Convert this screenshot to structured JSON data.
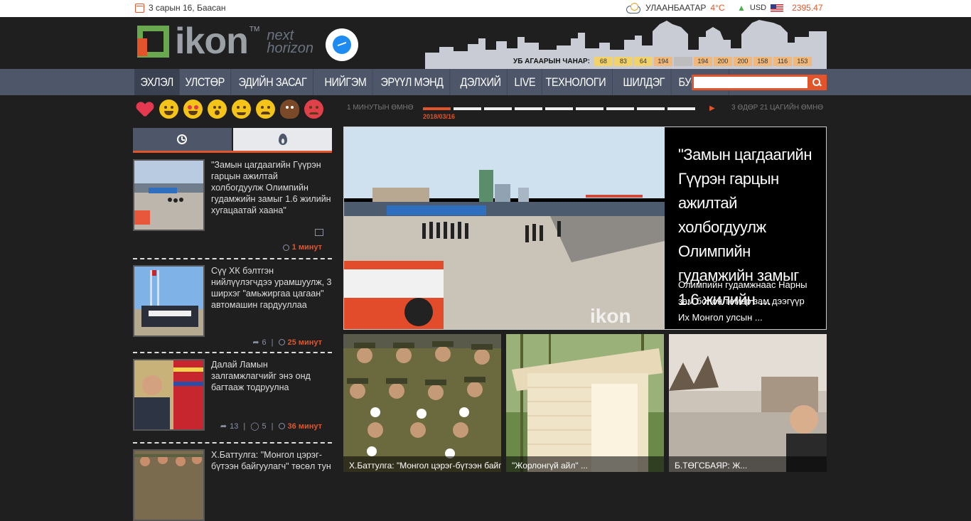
{
  "topbar": {
    "date": "3 сарын 16, Баасан",
    "city": "УЛААНБААТАР",
    "temp": "4°C",
    "currency": "USD",
    "rate": "2395.47"
  },
  "air_quality": {
    "label": "УБ АГААРЫН ЧАНАР:",
    "values": [
      "68",
      "83",
      "64",
      "194",
      "",
      "194",
      "200",
      "200",
      "158",
      "116",
      "153"
    ],
    "colors": [
      "#f2d36b",
      "#f2d36b",
      "#f2d36b",
      "#f0b87a",
      "#bdbdbd",
      "#f0b87a",
      "#f0b87a",
      "#f0b87a",
      "#f0b87a",
      "#f0b87a",
      "#f0b87a"
    ]
  },
  "logo": {
    "text": "ikon",
    "tm": "TM",
    "tagline_1": "next",
    "tagline_2": "horizon"
  },
  "nav": {
    "items": [
      "ЭХЛЭЛ",
      "УЛСТӨР",
      "ЭДИЙН ЗАСАГ",
      "НИЙГЭМ",
      "ЭРҮҮЛ МЭНД",
      "ДЭЛХИЙ",
      "LIVE",
      "ТЕХНОЛОГИ",
      "ШИЛДЭГ",
      "БУСАД"
    ],
    "search_placeholder": ""
  },
  "emojis": [
    "heart-icon",
    "laugh-icon",
    "heart-eyes-icon",
    "wow-icon",
    "hug-icon",
    "sad-icon",
    "poop-icon",
    "angry-icon"
  ],
  "timeline": {
    "left": "1 МИНУТЫН ӨМНӨ",
    "right": "3 ӨДӨР 21 ЦАГИЙН ӨМНӨ",
    "date": "2018/03/16",
    "segments": 9,
    "active_index": 0
  },
  "sidebar": {
    "items": [
      {
        "title": "\"Замын цагдаагийн Гүүрэн гарцын ажилтай холбогдуулж Олимпийн гудамжийн замыг 1.6 жилийн хугацаатай хаана\"",
        "shares": "",
        "comments": "",
        "time": "1 минут"
      },
      {
        "title": "Сүү ХК бэлтгэн нийлүүлэгчдээ урамшуулж, 3 ширхэг \"амьжиргаа цагаан\" автомашин гардууллаа",
        "shares": "6",
        "comments": "",
        "time": "25 минут"
      },
      {
        "title": "Далай Ламын залгамжлагчийг энэ онд багтааж тодруулна",
        "shares": "13",
        "comments": "5",
        "time": "36 минут"
      },
      {
        "title": "Х.Баттулга: \"Монгол цэрэг-бүтээн байгуулагч\" төсөл тун",
        "shares": "",
        "comments": "",
        "time": ""
      }
    ]
  },
  "feature": {
    "title": "\"Замын цагдаагийн Гүүрэн гарцын ажилтай холбогдуулж Олимпийн гудамжийн замыг 1.6 жилийн ...",
    "description": "Олимпийн гудамжнаас Нарны зам болон төмөр зам дээгүүр Их Монгол улсын ...",
    "watermark": "ikon"
  },
  "tiles": [
    {
      "caption": "Х.Баттулга: \"Монгол цэрэг-бүтээн байгуулагч\""
    },
    {
      "caption": "\"Жорлонгүй айл\" ..."
    },
    {
      "caption": "Б.ТӨГСБАЯР: Ж..."
    }
  ]
}
